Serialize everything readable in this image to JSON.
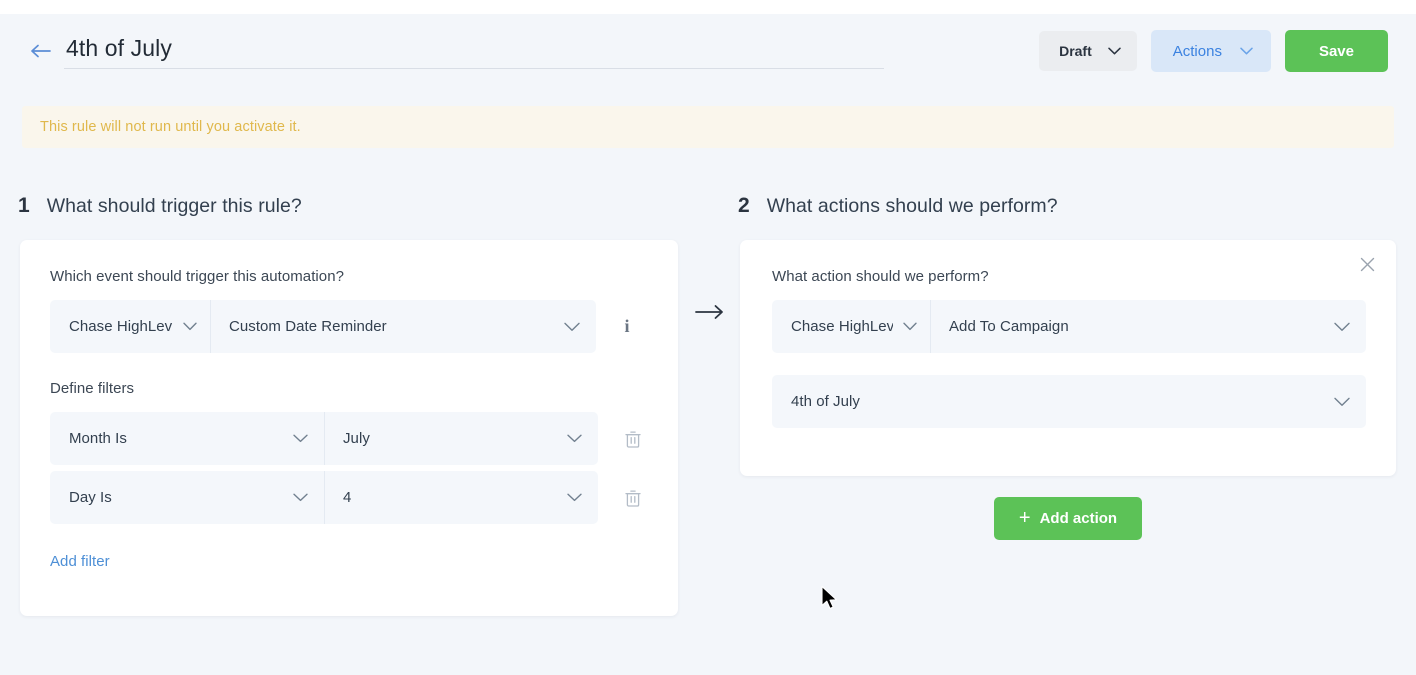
{
  "header": {
    "back_icon": "arrow-left-icon",
    "title": "4th of July",
    "status_label": "Draft",
    "actions_label": "Actions",
    "save_label": "Save"
  },
  "banner": {
    "text": "This rule will not run until you activate it."
  },
  "sections": {
    "trigger": {
      "number": "1",
      "title": "What should trigger this rule?"
    },
    "actions": {
      "number": "2",
      "title": "What actions should we perform?"
    }
  },
  "trigger_card": {
    "event_label": "Which event should trigger this automation?",
    "app_value": "Chase HighLev",
    "event_value": "Custom Date Reminder",
    "info_icon": "info-icon",
    "filters_label": "Define filters",
    "filters": [
      {
        "key": "Month Is",
        "value": "July",
        "delete_icon": "trash-icon"
      },
      {
        "key": "Day Is",
        "value": "4",
        "delete_icon": "trash-icon"
      }
    ],
    "add_filter_label": "Add filter"
  },
  "connector": {
    "icon": "arrow-right-icon"
  },
  "action_card": {
    "close_icon": "close-icon",
    "action_label": "What action should we perform?",
    "app_value": "Chase HighLev",
    "action_value": "Add To Campaign",
    "campaign_value": "4th of July",
    "add_action_label": "Add action"
  },
  "colors": {
    "page_bg": "#f3f6fa",
    "card_bg": "#ffffff",
    "accent_green": "#5cc257",
    "accent_blue": "#3b82e0",
    "warning_text": "#e0b84c",
    "warning_bg": "#faf6ec",
    "field_bg": "#f4f7fb"
  }
}
